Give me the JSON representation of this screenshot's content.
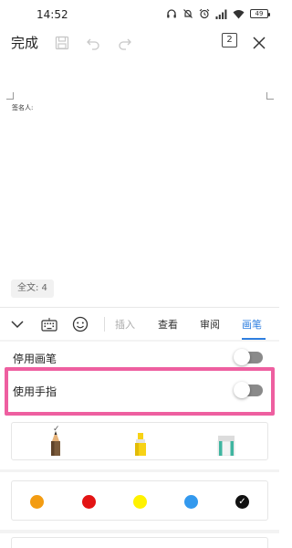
{
  "status_bar": {
    "time": "14:52",
    "battery": "49",
    "icons": [
      "headphones-icon",
      "mute-icon",
      "alarm-icon",
      "signal-icon",
      "wifi-icon",
      "battery-icon"
    ]
  },
  "toolbar": {
    "done_label": "完成",
    "icons": [
      "save-icon",
      "undo-icon",
      "redo-icon",
      "page-count-icon",
      "close-icon"
    ],
    "page_count": "2"
  },
  "document": {
    "signer_label": "签名人:",
    "word_count": "全文: 4"
  },
  "tab_bar": {
    "icons": [
      "collapse-chevron-icon",
      "keyboard-icon",
      "emoji-icon"
    ],
    "tabs": [
      {
        "label": "插入",
        "state": "disabled"
      },
      {
        "label": "查看",
        "state": "normal"
      },
      {
        "label": "审阅",
        "state": "normal"
      },
      {
        "label": "画笔",
        "state": "active"
      }
    ],
    "active_color": "#2f7fe0"
  },
  "settings": {
    "disable_pen_label": "停用画笔",
    "disable_pen_on": false,
    "use_finger_label": "使用手指",
    "use_finger_on": false
  },
  "highlight_color": "#ee5fa0",
  "pens": [
    {
      "name": "pencil",
      "selected": true
    },
    {
      "name": "highlighter",
      "selected": false
    },
    {
      "name": "eraser",
      "selected": false
    }
  ],
  "colors": [
    {
      "hex": "#f39c12",
      "selected": false
    },
    {
      "hex": "#e31414",
      "selected": false
    },
    {
      "hex": "#fff200",
      "selected": false
    },
    {
      "hex": "#3399ee",
      "selected": false
    },
    {
      "hex": "#111111",
      "selected": true
    }
  ]
}
